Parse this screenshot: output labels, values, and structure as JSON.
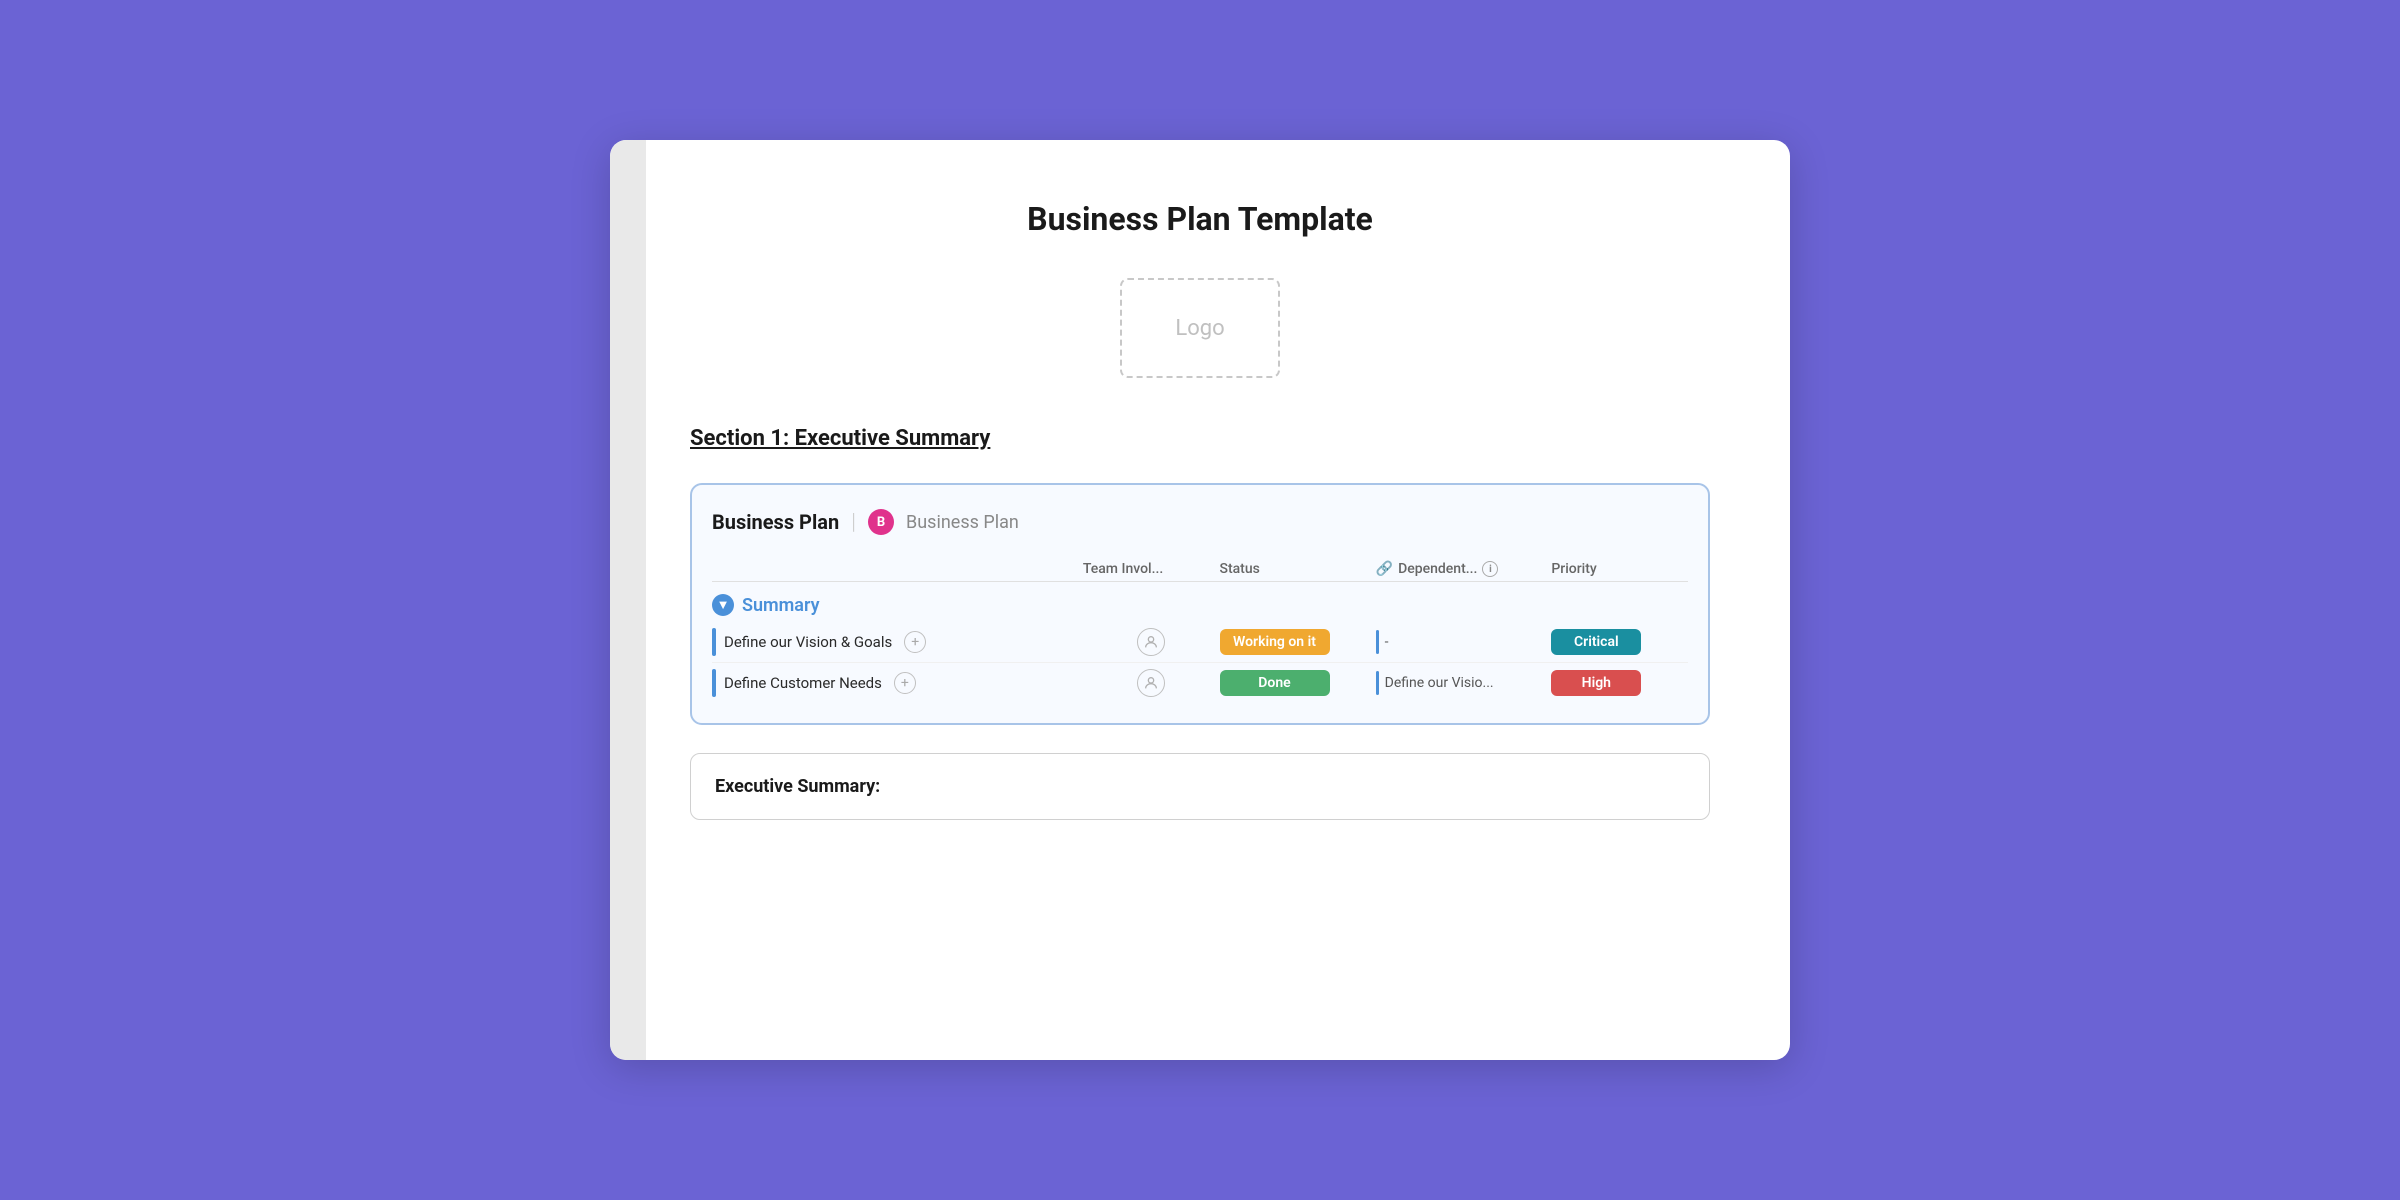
{
  "document": {
    "title": "Business Plan Template",
    "logo_placeholder": "Logo",
    "section_heading": "Section 1: Executive Summary"
  },
  "task_board": {
    "title": "Business Plan",
    "badge_letter": "B",
    "badge_label": "Business Plan",
    "group_label": "Summary",
    "columns": {
      "team": "Team Invol...",
      "status": "Status",
      "dependents_label": "Dependent...",
      "priority": "Priority"
    },
    "tasks": [
      {
        "name": "Define our Vision & Goals",
        "status": "Working on it",
        "status_class": "working",
        "dependency": "-",
        "priority": "Critical",
        "priority_class": "critical"
      },
      {
        "name": "Define Customer Needs",
        "status": "Done",
        "status_class": "done",
        "dependency": "Define our Visio...",
        "priority": "High",
        "priority_class": "high"
      }
    ]
  },
  "executive_summary": {
    "title": "Executive Summary:"
  }
}
